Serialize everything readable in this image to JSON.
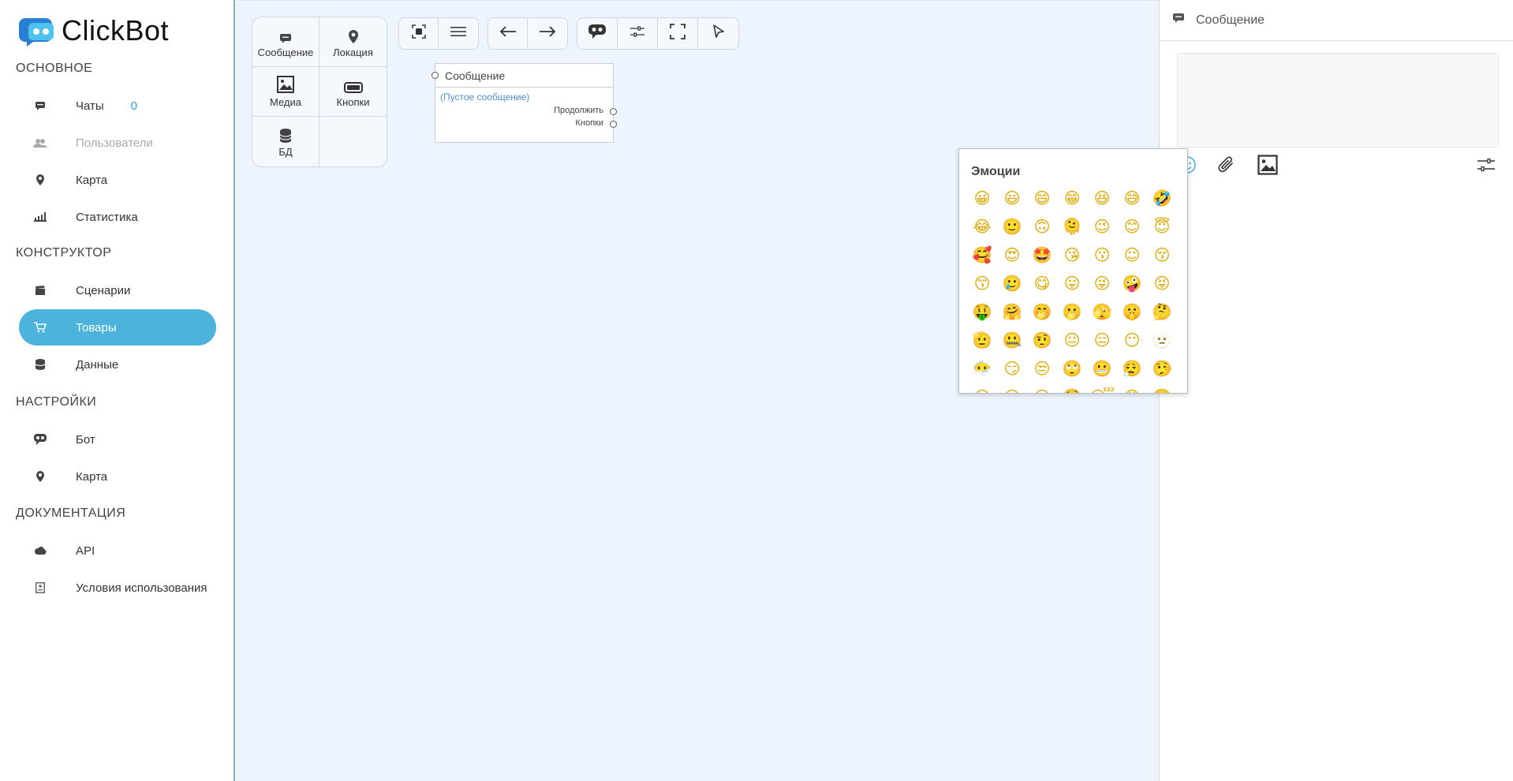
{
  "app": {
    "name": "ClickBot"
  },
  "sidebar": {
    "sections": [
      {
        "title": "ОСНОВНОЕ"
      },
      {
        "title": "КОНСТРУКТОР"
      },
      {
        "title": "НАСТРОЙКИ"
      },
      {
        "title": "ДОКУМЕНТАЦИЯ"
      }
    ],
    "items": [
      {
        "label": "Чаты",
        "badge": "0",
        "icon": "chat-icon"
      },
      {
        "label": "Пользователи",
        "icon": "users-icon"
      },
      {
        "label": "Карта",
        "icon": "map-pin-icon"
      },
      {
        "label": "Статистика",
        "icon": "stats-icon"
      },
      {
        "label": "Сценарии",
        "icon": "clapper-icon"
      },
      {
        "label": "Товары",
        "icon": "cart-icon"
      },
      {
        "label": "Данные",
        "icon": "database-icon"
      },
      {
        "label": "Бот",
        "icon": "bot-icon"
      },
      {
        "label": "Карта",
        "icon": "map-pin-icon"
      },
      {
        "label": "API",
        "icon": "cloud-icon"
      },
      {
        "label": "Условия использования",
        "icon": "document-icon"
      }
    ]
  },
  "palette": {
    "items": [
      {
        "label": "Сообщение",
        "icon": "message-icon"
      },
      {
        "label": "Локация",
        "icon": "map-pin-icon"
      },
      {
        "label": "Медиа",
        "icon": "image-icon"
      },
      {
        "label": "Кнопки",
        "icon": "button-icon"
      },
      {
        "label": "БД",
        "icon": "database-icon"
      }
    ]
  },
  "node": {
    "title": "Сообщение",
    "body": "(Пустое сообщение)",
    "outputs": [
      "Продолжить",
      "Кнопки"
    ]
  },
  "panel": {
    "title": "Сообщение"
  },
  "emoji_picker": {
    "title": "Эмоции",
    "emojis": [
      "😀",
      "😃",
      "😄",
      "😁",
      "😆",
      "😅",
      "🤣",
      "😂",
      "🙂",
      "🙃",
      "🫠",
      "😉",
      "😊",
      "😇",
      "🥰",
      "😍",
      "🤩",
      "😘",
      "😗",
      "☺",
      "😚",
      "😙",
      "🥲",
      "😋",
      "😛",
      "😜",
      "🤪",
      "😝",
      "🤑",
      "🤗",
      "🤭",
      "🫢",
      "🫣",
      "🤫",
      "🤔",
      "🫡",
      "🤐",
      "🤨",
      "😐",
      "😑",
      "😶",
      "🫥",
      "😶‍🌫️",
      "😏",
      "😒",
      "🙄",
      "😬",
      "😮‍💨",
      "🤥",
      "😌",
      "😔",
      "😪",
      "🤤",
      "😴",
      "😷",
      "🤒"
    ]
  },
  "colors": {
    "accent": "#4bb3dc",
    "canvas": "#edf4fd",
    "badge": "#2ea3e0"
  }
}
